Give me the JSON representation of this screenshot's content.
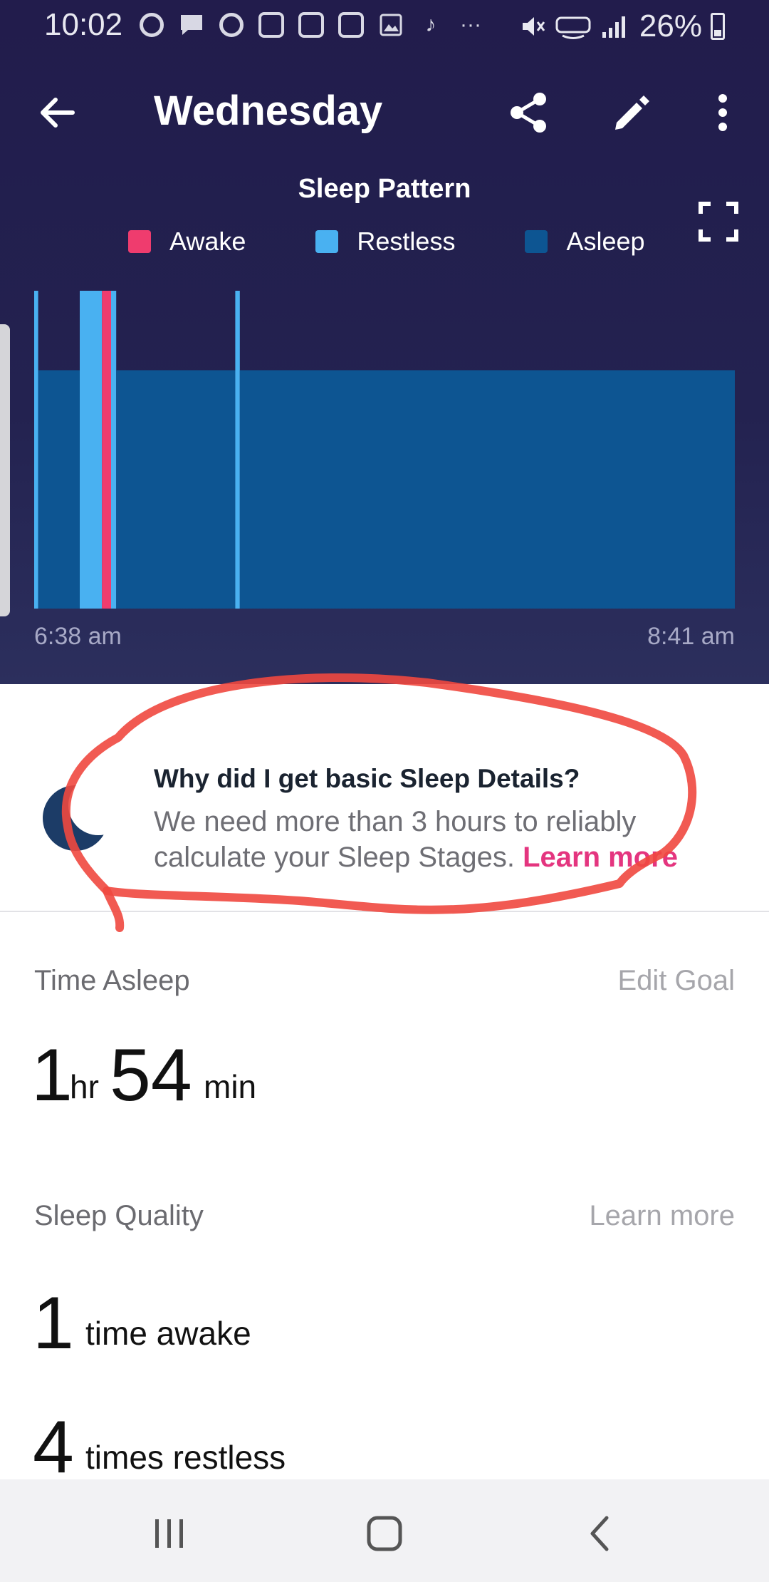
{
  "status_bar": {
    "time": "10:02",
    "battery": "26%",
    "icons": [
      "alexa-icon",
      "message-icon",
      "alexa-icon",
      "app-icon",
      "app-icon",
      "app-icon",
      "gallery-icon",
      "tiktok-icon",
      "more-dots-icon",
      "mute-icon",
      "volte-icon",
      "signal-icon"
    ],
    "more": "···"
  },
  "app_bar": {
    "title": "Wednesday"
  },
  "chart_data": {
    "type": "area",
    "title": "Sleep Pattern",
    "legend": [
      {
        "name": "Awake",
        "color": "#ef3c6e"
      },
      {
        "name": "Restless",
        "color": "#49b1f1"
      },
      {
        "name": "Asleep",
        "color": "#0d5592"
      }
    ],
    "x_start_label": "6:38 am",
    "x_end_label": "8:41 am",
    "x_range_minutes": [
      0,
      123
    ],
    "segments": [
      {
        "stage": "Restless",
        "start": 0.0,
        "end": 0.7
      },
      {
        "stage": "Asleep",
        "start": 0.7,
        "end": 8.0
      },
      {
        "stage": "Restless",
        "start": 8.0,
        "end": 11.9
      },
      {
        "stage": "Awake",
        "start": 11.9,
        "end": 13.5
      },
      {
        "stage": "Restless",
        "start": 13.5,
        "end": 14.4
      },
      {
        "stage": "Asleep",
        "start": 14.4,
        "end": 35.3
      },
      {
        "stage": "Restless",
        "start": 35.3,
        "end": 36.1
      },
      {
        "stage": "Asleep",
        "start": 36.1,
        "end": 123.0
      }
    ],
    "stage_levels": {
      "Awake": 1.0,
      "Restless": 1.0,
      "Asleep": 0.75
    },
    "colors": {
      "Awake": "#ef3c6e",
      "Restless": "#49b1f1",
      "Asleep": "#0d5592"
    }
  },
  "info": {
    "title": "Why did I get basic Sleep Details?",
    "text": "We need more than 3 hours to reliably calculate your Sleep Stages.",
    "link": "Learn more"
  },
  "time_asleep": {
    "label": "Time Asleep",
    "action": "Edit Goal",
    "hours": "1",
    "hours_unit": "hr",
    "minutes": "54",
    "minutes_unit": "min"
  },
  "sleep_quality": {
    "label": "Sleep Quality",
    "action": "Learn more",
    "awake_count": "1",
    "awake_label": "time awake",
    "restless_count": "4",
    "restless_label": "times restless"
  },
  "colors": {
    "header_bg": "#221c4c",
    "accent_pink": "#e4357f",
    "annotation_red": "#f0483f"
  }
}
